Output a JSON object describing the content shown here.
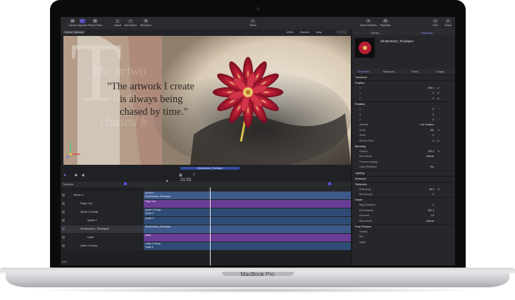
{
  "device": {
    "model_label": "MacBook Pro"
  },
  "toolbar": {
    "buttons": [
      {
        "label": "Library"
      },
      {
        "label": "Inspector"
      },
      {
        "label": "Project Pane"
      },
      {
        "label": "Import"
      },
      {
        "label": "Add Object"
      },
      {
        "label": "Behaviors"
      },
      {
        "label": "Filters"
      },
      {
        "label": "Make Particles"
      },
      {
        "label": "Replicate"
      },
      {
        "label": "HUD"
      },
      {
        "label": "Share"
      }
    ]
  },
  "canvas_bar": {
    "camera": "Active Camera",
    "zoom": "128%",
    "render": "Render",
    "view": "View"
  },
  "viewer": {
    "quote_lines": [
      "\"The artwork I create",
      "is always being",
      "chased by time.\""
    ],
    "ghost_lines": [
      "The artwo",
      "is alw",
      "chased b"
    ],
    "ghost_letter": "T",
    "selection_label": "Shutterstock_Timelapse"
  },
  "transport": {
    "timecode": "21:03"
  },
  "timeline": {
    "header_label": "Timeline",
    "layers": [
      {
        "name": "Scene 4",
        "indent": 0
      },
      {
        "name": "Page Curl",
        "indent": 1
      },
      {
        "name": "Quote 4 Group",
        "indent": 1
      },
      {
        "name": "Quote 4",
        "indent": 2
      },
      {
        "name": "Shutterstock_Timelapse",
        "indent": 1
      },
      {
        "name": "Layer",
        "indent": 2
      },
      {
        "name": "Letter 4 Group",
        "indent": 1
      }
    ],
    "tracks": [
      {
        "labels": [
          "Scene 4",
          "Shutterstock_Timelapse"
        ],
        "color": "#3d5a8a"
      },
      {
        "labels": [
          "Page Curl"
        ],
        "color": "#6a3d94"
      },
      {
        "labels": [
          "Quote 4 Group",
          "Quote 4"
        ],
        "color": "#2f4c74"
      },
      {
        "labels": [
          "Quote 4"
        ],
        "color": "#2f4c74"
      },
      {
        "labels": [
          "Shutterstock_Timelapse"
        ],
        "color": "#3d5a8a"
      },
      {
        "labels": [
          "Mask"
        ],
        "color": "#6a3d94"
      },
      {
        "labels": [
          "Letter 4 Group",
          "Letter 4"
        ],
        "color": "#2f4c74"
      }
    ],
    "footer_label": "Mini"
  },
  "right_panel": {
    "tabs": [
      "Library",
      "Inspector"
    ],
    "clip_title": "Shutterstock_Timelapse",
    "sub_tabs": [
      "Properties",
      "Behaviors",
      "Filters",
      "Image"
    ],
    "sections": {
      "transform": "Transform",
      "position": "Position",
      "rotation": "Rotation",
      "blending": "Blending",
      "lighting": "Lighting",
      "shadows": "Shadows",
      "reflection": "Reflection",
      "falloff": "Falloff",
      "drop_shadow": "Drop Shadow"
    },
    "rows": [
      {
        "label": "X",
        "value": "606.0",
        "unit": "px"
      },
      {
        "label": "Y",
        "value": "0",
        "unit": "px"
      },
      {
        "label": "Z",
        "value": "0",
        "unit": "px"
      },
      {
        "label": "X",
        "value": "0",
        "unit": "°"
      },
      {
        "label": "Y",
        "value": "0",
        "unit": "°"
      },
      {
        "label": "Z",
        "value": "0",
        "unit": "°"
      },
      {
        "label": "Animate",
        "value": "Use Rotation",
        "unit": ""
      },
      {
        "label": "Scale",
        "value": "100",
        "unit": "%"
      },
      {
        "label": "Shear",
        "value": "0",
        "unit": "°"
      },
      {
        "label": "Anchor Point",
        "value": "0",
        "unit": "px"
      },
      {
        "label": "Opacity",
        "value": "100.0",
        "unit": "%"
      },
      {
        "label": "Blend Mode",
        "value": "Normal",
        "unit": ""
      },
      {
        "label": "Preserve Opacity",
        "value": "",
        "unit": ""
      },
      {
        "label": "Casts Reflection",
        "value": "Yes",
        "unit": ""
      },
      {
        "label": "Reflectivity",
        "value": "80.0",
        "unit": "%"
      },
      {
        "label": "Blur Amount",
        "value": "0",
        "unit": ""
      },
      {
        "label": "Begin Distance",
        "value": "0",
        "unit": ""
      },
      {
        "label": "End Distance",
        "value": "500.0",
        "unit": ""
      },
      {
        "label": "Exponent",
        "value": "1.6",
        "unit": ""
      },
      {
        "label": "Blend Mode",
        "value": "Normal",
        "unit": ""
      },
      {
        "label": "Opacity",
        "value": "",
        "unit": ""
      },
      {
        "label": "Blur",
        "value": "",
        "unit": ""
      },
      {
        "label": "Angle",
        "value": "",
        "unit": ""
      }
    ]
  },
  "colors": {
    "accent": "#5b4fe0",
    "track_purple": "#6a3d94",
    "track_blue": "#3d5a8a",
    "panel": "#26272a"
  }
}
